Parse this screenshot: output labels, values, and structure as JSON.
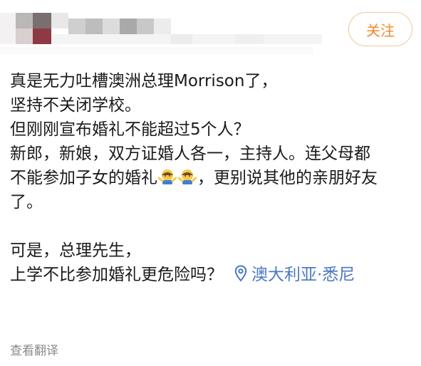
{
  "header": {
    "follow_label": "关注"
  },
  "post": {
    "lines": [
      "真是无力吐槽澳洲总理Morrison了，",
      "坚持不关闭学校。",
      "但刚刚宣布婚礼不能超过5个人？",
      "新郎，新娘，双方证婚人各一，主持人。连父母都",
      "不能参加子女的婚礼",
      "，更别说其他的亲朋好友",
      "了。",
      "",
      "可是，总理先生，",
      "上学不比参加婚礼更危险吗？"
    ],
    "emoji": [
      "shrug-emoji",
      "shrug-emoji"
    ],
    "location": "澳大利亚·悉尼"
  },
  "footer": {
    "translate_label": "查看翻译"
  },
  "colors": {
    "accent_orange": "#ef8a2a",
    "link_blue": "#4a79c3"
  }
}
